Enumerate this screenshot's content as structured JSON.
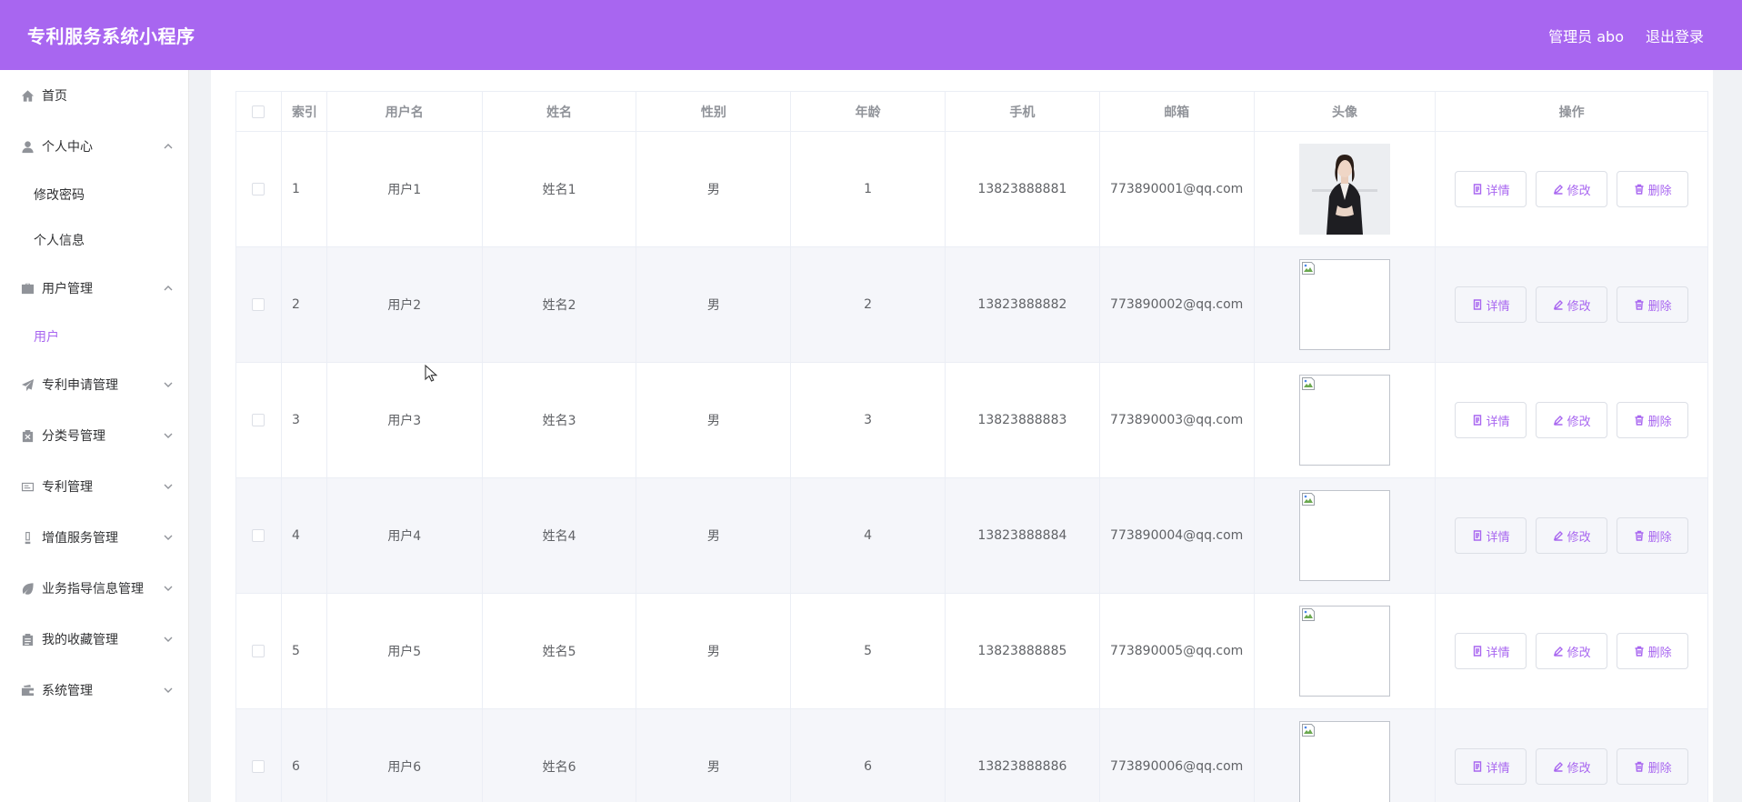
{
  "header": {
    "title": "专利服务系统小程序",
    "user_label": "管理员 abo",
    "logout_label": "退出登录"
  },
  "sidebar": {
    "home": "首页",
    "personal": {
      "label": "个人中心",
      "children": [
        "修改密码",
        "个人信息"
      ]
    },
    "user_mgmt": {
      "label": "用户管理",
      "children": [
        "用户"
      ]
    },
    "collapsed": [
      "专利申请管理",
      "分类号管理",
      "专利管理",
      "增值服务管理",
      "业务指导信息管理",
      "我的收藏管理",
      "系统管理"
    ]
  },
  "table": {
    "headers": [
      "索引",
      "用户名",
      "姓名",
      "性别",
      "年龄",
      "手机",
      "邮箱",
      "头像",
      "操作"
    ],
    "rows": [
      {
        "index": "1",
        "username": "用户1",
        "name": "姓名1",
        "gender": "男",
        "age": "1",
        "phone": "13823888881",
        "email": "773890001@qq.com"
      },
      {
        "index": "2",
        "username": "用户2",
        "name": "姓名2",
        "gender": "男",
        "age": "2",
        "phone": "13823888882",
        "email": "773890002@qq.com"
      },
      {
        "index": "3",
        "username": "用户3",
        "name": "姓名3",
        "gender": "男",
        "age": "3",
        "phone": "13823888883",
        "email": "773890003@qq.com"
      },
      {
        "index": "4",
        "username": "用户4",
        "name": "姓名4",
        "gender": "男",
        "age": "4",
        "phone": "13823888884",
        "email": "773890004@qq.com"
      },
      {
        "index": "5",
        "username": "用户5",
        "name": "姓名5",
        "gender": "男",
        "age": "5",
        "phone": "13823888885",
        "email": "773890005@qq.com"
      },
      {
        "index": "6",
        "username": "用户6",
        "name": "姓名6",
        "gender": "男",
        "age": "6",
        "phone": "13823888886",
        "email": "773890006@qq.com"
      }
    ],
    "actions": {
      "detail": "详情",
      "edit": "修改",
      "delete": "删除"
    }
  },
  "colors": {
    "accent": "#a866f0",
    "border": "#ebeef5",
    "stripe": "#f5f6fa"
  }
}
